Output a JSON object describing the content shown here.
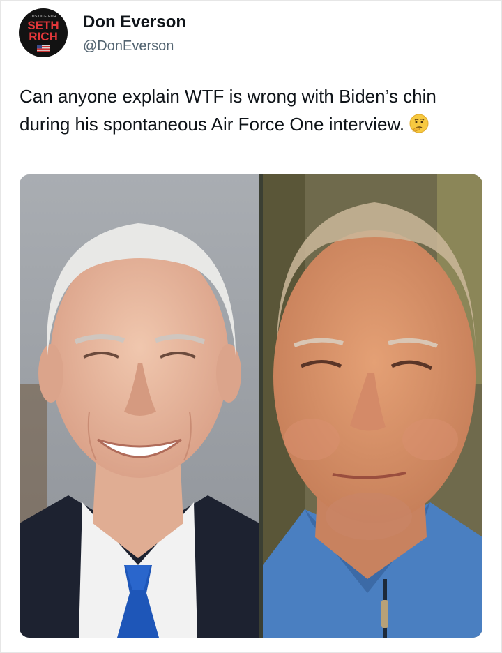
{
  "author": {
    "name": "Don Everson",
    "handle": "@DonEverson",
    "avatar": {
      "top_text": "JUSTICE FOR",
      "line1": "SETH",
      "line2": "RICH",
      "accent_color": "#e2373a"
    }
  },
  "tweet": {
    "text": "Can anyone explain WTF is wrong with Biden’s chin during his spontaneous Air Force One interview.",
    "emoji": "thinking-face-icon"
  },
  "media": {
    "left_photo": "portrait-smiling-suit",
    "right_photo": "portrait-blue-sweater"
  }
}
